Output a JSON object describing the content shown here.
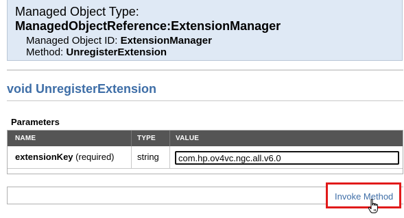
{
  "header": {
    "type_label": "Managed Object Type:",
    "type_value": "ManagedObjectReference:ExtensionManager",
    "id_label": "Managed Object ID: ",
    "id_value": "ExtensionManager",
    "method_label": "Method: ",
    "method_value": "UnregisterExtension"
  },
  "method_title": "void UnregisterExtension",
  "parameters": {
    "section_label": "Parameters",
    "columns": [
      "NAME",
      "TYPE",
      "VALUE"
    ],
    "rows": [
      {
        "name": "extensionKey",
        "qualifier": " (required)",
        "type": "string",
        "value": "com.hp.ov4vc.ngc.all.v6.0"
      }
    ]
  },
  "invoke": {
    "label": "Invoke Method"
  },
  "colors": {
    "header_bg": "#dfe9f5",
    "link": "#3e6ea7",
    "table_header_bg": "#555555",
    "highlight": "#e11a1a"
  },
  "icons": {
    "cursor": "hand-pointer-icon"
  }
}
